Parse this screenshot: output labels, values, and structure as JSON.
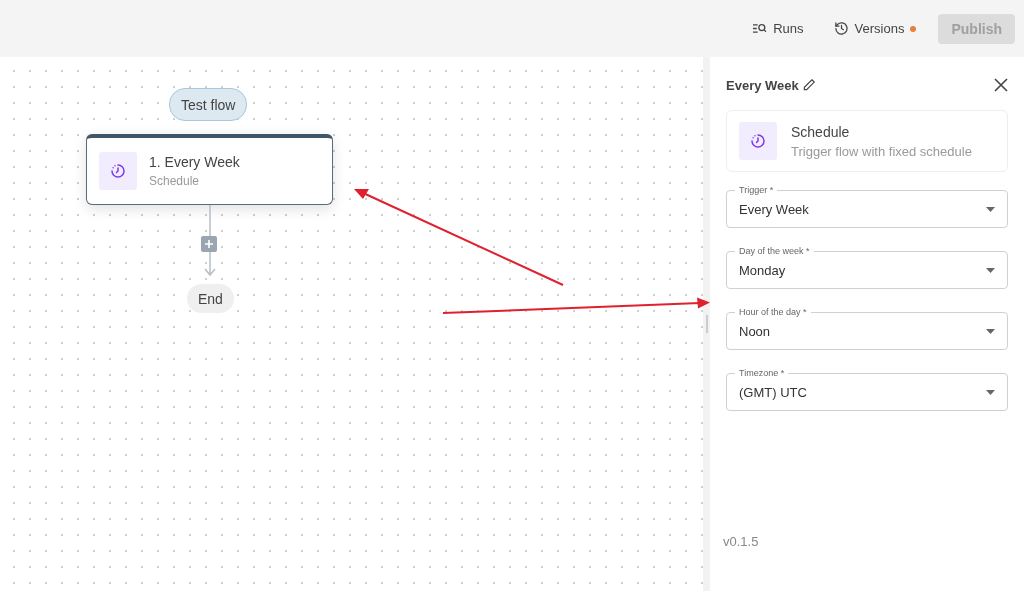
{
  "toolbar": {
    "runs": "Runs",
    "versions": "Versions",
    "versions_changed": true,
    "publish": {
      "label": "Publish",
      "disabled": true
    }
  },
  "canvas": {
    "test_flow": "Test flow",
    "step": {
      "title": "1. Every Week",
      "subtitle": "Schedule"
    },
    "end": "End"
  },
  "panel": {
    "title": "Every Week",
    "trigger_card": {
      "title": "Schedule",
      "description": "Trigger flow with fixed schedule"
    },
    "fields": [
      {
        "label": "Trigger *",
        "value": "Every Week"
      },
      {
        "label": "Day of the week *",
        "value": "Monday"
      },
      {
        "label": "Hour of the day *",
        "value": "Noon"
      },
      {
        "label": "Timezone *",
        "value": "(GMT) UTC"
      }
    ],
    "version": "v0.1.5"
  }
}
